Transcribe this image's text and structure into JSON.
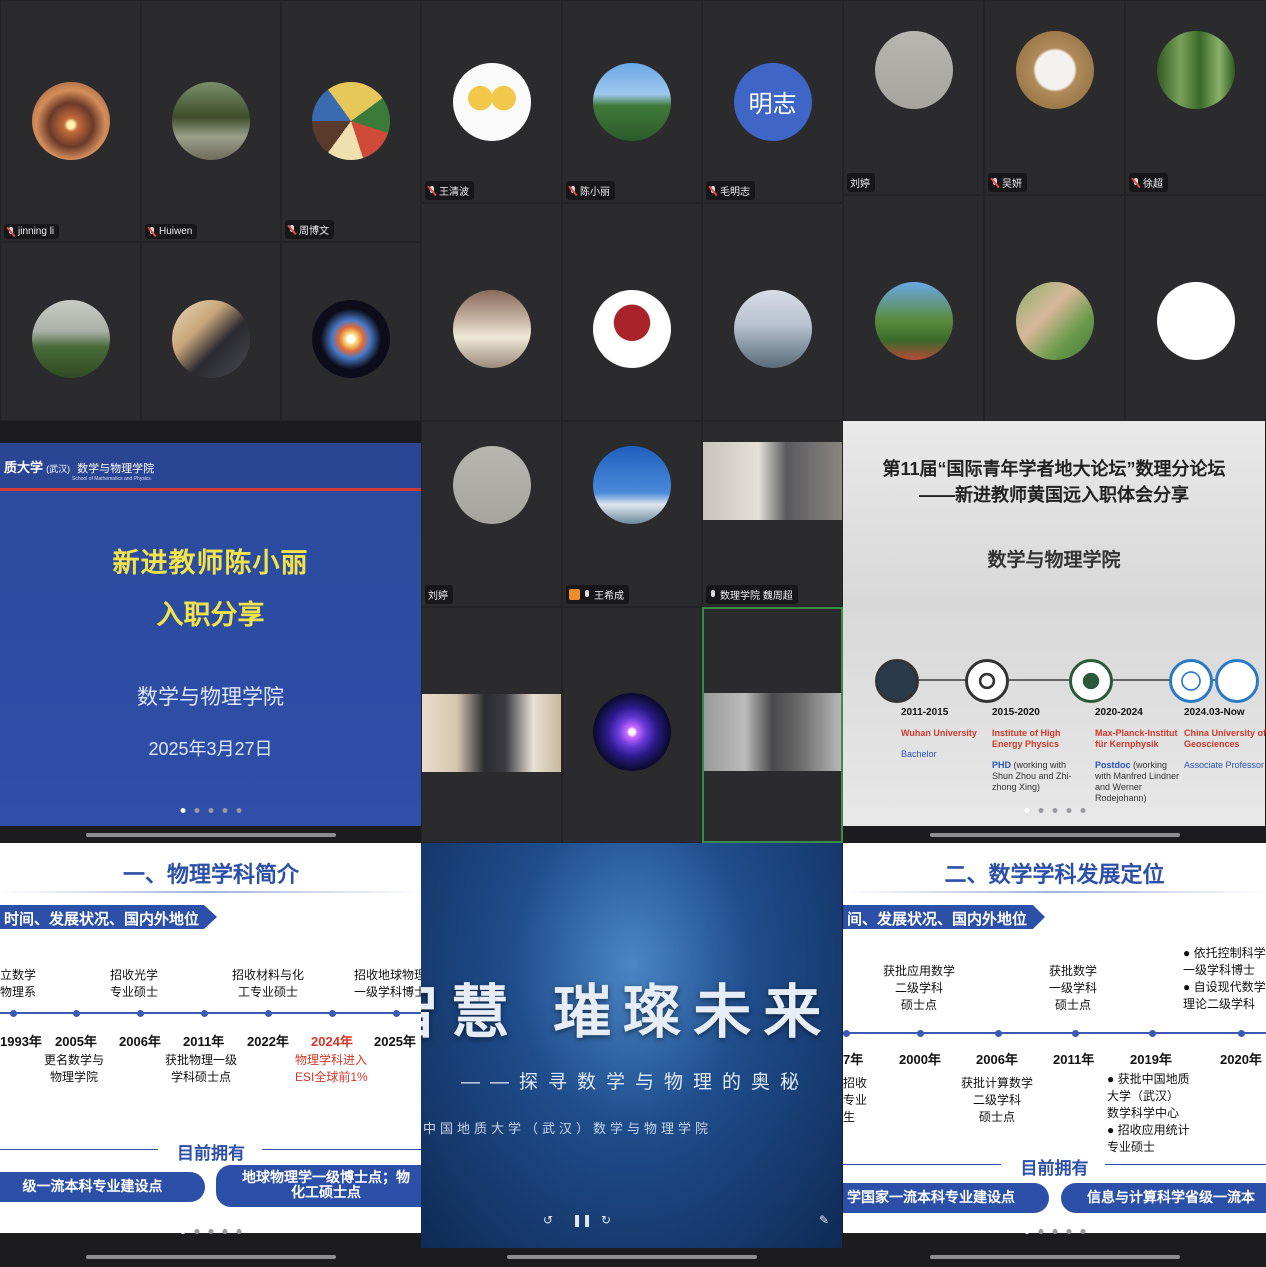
{
  "panel1": {
    "participants": [
      {
        "name": "jinning li",
        "muted": true,
        "avatar": "portal-photo-icon"
      },
      {
        "name": "Huiwen",
        "muted": true,
        "avatar": "tree-road-photo-icon"
      },
      {
        "name": "周博文",
        "muted": true,
        "avatar": "cartoon-icon"
      },
      {
        "name": "",
        "avatar": "foggy-hill-photo-icon"
      },
      {
        "name": "",
        "avatar": "person-photo-icon"
      },
      {
        "name": "",
        "avatar": "nebula-photo-icon"
      }
    ]
  },
  "panel2": {
    "participants": [
      {
        "name": "王清波",
        "muted": true,
        "avatar": "cartoon-ducks-icon"
      },
      {
        "name": "陈小丽",
        "muted": true,
        "avatar": "palm-tree-photo-icon"
      },
      {
        "name": "毛明志",
        "muted": true,
        "avatar_text": "明志",
        "avatar_color": "#3f66c7"
      },
      {
        "name": "",
        "avatar": "child-photo-icon"
      },
      {
        "name": "",
        "avatar": "university-logo-icon"
      },
      {
        "name": "",
        "avatar": "child-beach-photo-icon"
      }
    ]
  },
  "panel3": {
    "participants": [
      {
        "name": "刘婷",
        "muted": false,
        "avatar": "sticks-photo-icon"
      },
      {
        "name": "吴妍",
        "muted": true,
        "avatar": "cat-photo-icon"
      },
      {
        "name": "徐超",
        "muted": true,
        "avatar": "forest-photo-icon"
      },
      {
        "name": "",
        "avatar": "road-sign-photo-icon"
      },
      {
        "name": "",
        "avatar": "hand-leaf-photo-icon"
      },
      {
        "name": "",
        "avatar": "blank-white-icon"
      }
    ]
  },
  "slide1": {
    "header_uni": "质大学",
    "header_campus": "(武汉)",
    "header_school": "数学与物理学院",
    "header_school_en": "School of Mathematics and Physics",
    "title_line1": "新进教师陈小丽",
    "title_line2": "入职分享",
    "school": "数学与物理学院",
    "date": "2025年3月27日"
  },
  "panel5": {
    "participants": [
      {
        "name": "刘婷",
        "muted": false,
        "avatar": "sticks-photo-icon"
      },
      {
        "name": "王希成",
        "muted": false,
        "avatar": "sky-building-photo-icon",
        "phone": true
      },
      {
        "name": "数理学院 魏周超",
        "muted": false,
        "video": true
      },
      {
        "name": "",
        "video": true
      },
      {
        "name": "",
        "avatar": "plasma-ball-photo-icon"
      },
      {
        "name": "",
        "video": true,
        "active": true
      }
    ]
  },
  "slide4": {
    "title_line1": "第11届“国际青年学者地大论坛”数理分论坛",
    "title_line2": "——新进教师黄国远入职体会分享",
    "school": "数学与物理学院",
    "timeline": [
      {
        "years": "2011-2015",
        "org": "Wuhan University",
        "role": "Bachelor",
        "research": ""
      },
      {
        "years": "2015-2020",
        "org": "Institute of High Energy Physics",
        "role": "PHD",
        "research": "(working with Shun Zhou and Zhi-zhong Xing)"
      },
      {
        "years": "2020-2024",
        "org": "Max-Planck-Institut für Kernphysik",
        "role": "Postdoc",
        "research": "(working with Manfred Lindner and Werner Rodejohann)"
      },
      {
        "years": "2024.03-Now",
        "org": "China University of Geosciences",
        "role": "Associate Professor",
        "research": ""
      }
    ]
  },
  "slide_physics": {
    "title": "一、物理学科简介",
    "tag": "时间、发展状况、国内外地位",
    "years": [
      "1993年",
      "2005年",
      "2006年",
      "2011年",
      "2022年",
      "2024年",
      "2025年"
    ],
    "above": [
      "立数学\n物理系",
      "招收光学\n专业硕士",
      "招收材料与化\n工专业硕士",
      "招收地球物理\n一级学科博士"
    ],
    "below": [
      "更名数学与\n物理学院",
      "获批物理一级\n学科硕士点",
      "物理学科进入\nESI全球前1%"
    ],
    "have": "目前拥有",
    "pill1": "级一流本科专业建设点",
    "pill2": "地球物理学一级博士点；物\n化工硕士点"
  },
  "slide_video": {
    "big_text": "智慧  璀璨未来",
    "subtitle": "——探寻数学与物理的奥秘",
    "school": "中国地质大学（武汉）数学与物理学院"
  },
  "slide_math": {
    "title": "二、数学学科发展定位",
    "tag": "间、发展状况、国内外地位",
    "years": [
      "7年",
      "2000年",
      "2006年",
      "2011年",
      "2019年",
      "2020年"
    ],
    "above": [
      "获批应用数学\n二级学科\n硕士点",
      "获批数学\n一级学科\n硕士点"
    ],
    "above_list": [
      "依托控制科学\n一级学科博士",
      "自设现代数学\n理论二级学科"
    ],
    "below": [
      "招收\n专业\n生",
      "获批计算数学\n二级学科\n硕士点"
    ],
    "below_list": [
      "获批中国地质\n大学（武汉）\n数学科学中心",
      "招收应用统计\n专业硕士"
    ],
    "have": "目前拥有",
    "pill1": "学国家一流本科专业建设点",
    "pill2": "信息与计算科学省级一流本"
  }
}
